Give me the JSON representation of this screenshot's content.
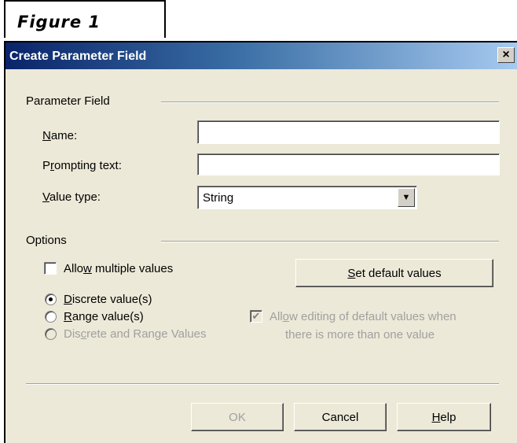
{
  "figure_label": "Figure 1",
  "window": {
    "title": "Create Parameter Field",
    "close_glyph": "×"
  },
  "parameter_group": {
    "label": "Parameter Field"
  },
  "fields": {
    "name": {
      "label_pre": "",
      "label_key": "N",
      "label_post": "ame:",
      "value": ""
    },
    "prompting_text": {
      "label_pre": "P",
      "label_key": "r",
      "label_post": "ompting text:",
      "value": ""
    },
    "value_type": {
      "label_pre": "",
      "label_key": "V",
      "label_post": "alue type:",
      "selected": "String",
      "arrow": "▼"
    }
  },
  "options_group": {
    "label": "Options"
  },
  "options": {
    "allow_multiple": {
      "pre": "Allo",
      "key": "w",
      "post": " multiple values",
      "checked": false
    },
    "set_default_button": {
      "pre": "",
      "key": "S",
      "post": "et default values"
    },
    "discrete": {
      "pre": "",
      "key": "D",
      "post": "iscrete value(s)",
      "selected": true
    },
    "range": {
      "pre": "",
      "key": "R",
      "post": "ange value(s)",
      "selected": false
    },
    "discrete_and_range": {
      "pre": "Dis",
      "key": "c",
      "post": "rete and Range Values",
      "selected": false,
      "disabled": true
    },
    "allow_editing": {
      "line1_pre": "All",
      "line1_key": "o",
      "line1_post": "w editing of default values when",
      "line2": "there is more than one value",
      "checked": true,
      "disabled": true,
      "check_glyph": "✔"
    }
  },
  "buttons": {
    "ok": "OK",
    "cancel": "Cancel",
    "help": {
      "pre": "",
      "key": "H",
      "post": "elp"
    }
  }
}
